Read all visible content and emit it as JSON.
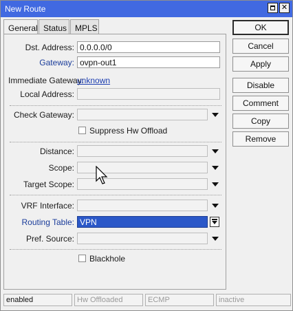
{
  "window": {
    "title": "New Route"
  },
  "tabs": [
    {
      "label": "General",
      "active": true
    },
    {
      "label": "Status",
      "active": false
    },
    {
      "label": "MPLS",
      "active": false
    }
  ],
  "form": {
    "dst_address": {
      "label": "Dst. Address:",
      "value": "0.0.0.0/0"
    },
    "gateway": {
      "label": "Gateway:",
      "value": "ovpn-out1"
    },
    "immediate_gateway": {
      "label": "Immediate Gateway:",
      "value": "unknown"
    },
    "local_address": {
      "label": "Local Address:",
      "value": ""
    },
    "check_gateway": {
      "label": "Check Gateway:",
      "value": ""
    },
    "suppress_hw_offload": {
      "label": "Suppress Hw Offload",
      "checked": false
    },
    "distance": {
      "label": "Distance:",
      "value": ""
    },
    "scope": {
      "label": "Scope:",
      "value": ""
    },
    "target_scope": {
      "label": "Target Scope:",
      "value": ""
    },
    "vrf_interface": {
      "label": "VRF Interface:",
      "value": ""
    },
    "routing_table": {
      "label": "Routing Table:",
      "value": "VPN"
    },
    "pref_source": {
      "label": "Pref. Source:",
      "value": ""
    },
    "blackhole": {
      "label": "Blackhole",
      "checked": false
    }
  },
  "buttons": {
    "ok": "OK",
    "cancel": "Cancel",
    "apply": "Apply",
    "disable": "Disable",
    "comment": "Comment",
    "copy": "Copy",
    "remove": "Remove"
  },
  "status_bar": [
    "enabled",
    "Hw Offloaded",
    "ECMP",
    "inactive"
  ],
  "colors": {
    "titlebar": "#4169e1",
    "selection": "#2b58c8",
    "link": "#1a3cb0",
    "label_blue": "#1a3c9a"
  }
}
